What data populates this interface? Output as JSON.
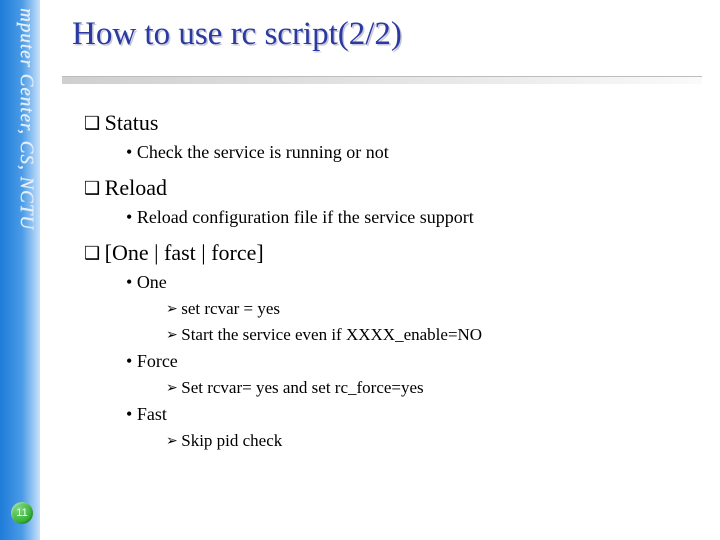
{
  "sidebar": {
    "label": "mputer Center, CS, NCTU"
  },
  "page_number": "11",
  "title": "How to use rc script(2/2)",
  "sections": {
    "status": {
      "heading": "Status",
      "bullet1": "Check the service is running or not"
    },
    "reload": {
      "heading": "Reload",
      "bullet1": "Reload configuration file if the service support"
    },
    "off": {
      "heading": "[One | fast | force]",
      "one": {
        "label": "One",
        "a1": "set rcvar = yes",
        "a2": "Start the service even if XXXX_enable=NO"
      },
      "force": {
        "label": "Force",
        "a1": "Set rcvar= yes and set rc_force=yes"
      },
      "fast": {
        "label": "Fast",
        "a1": "Skip pid check"
      }
    }
  }
}
